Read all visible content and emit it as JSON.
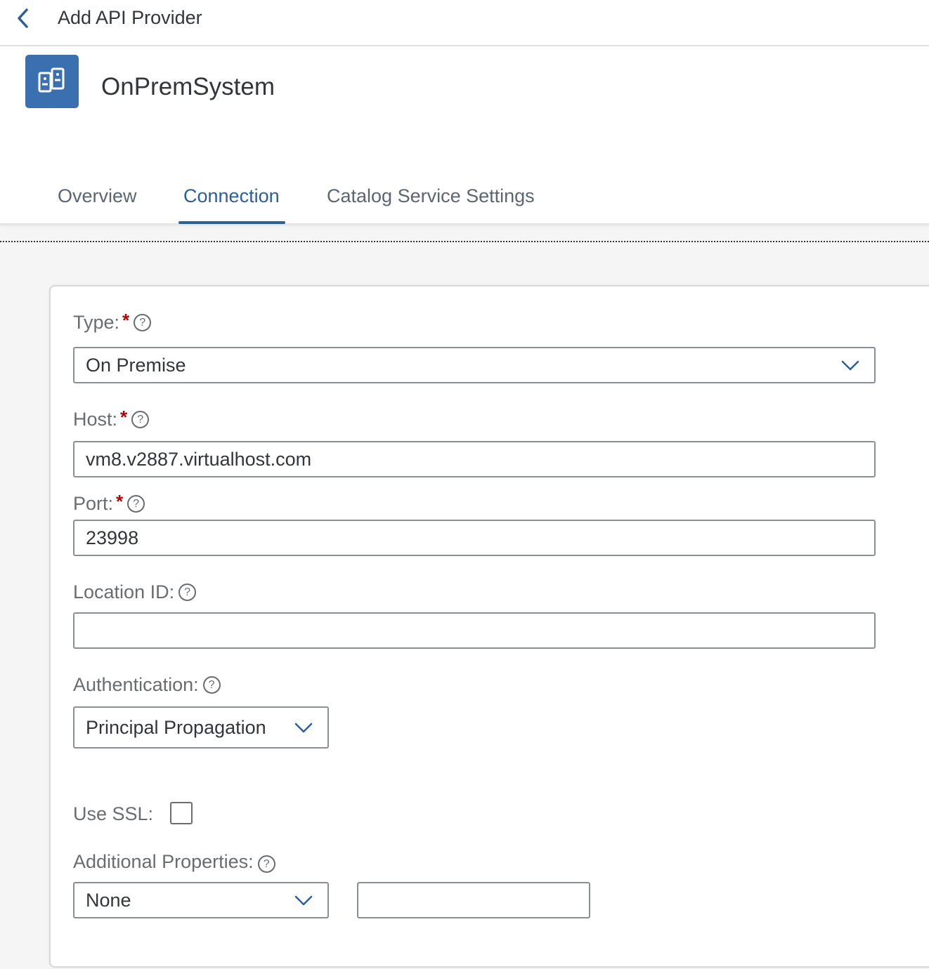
{
  "topbar": {
    "title": "Add API Provider"
  },
  "header": {
    "title": "OnPremSystem"
  },
  "tabs": [
    {
      "label": "Overview"
    },
    {
      "label": "Connection"
    },
    {
      "label": "Catalog Service Settings"
    }
  ],
  "form": {
    "type": {
      "label": "Type:",
      "value": "On Premise"
    },
    "host": {
      "label": "Host:",
      "value": "vm8.v2887.virtualhost.com"
    },
    "port": {
      "label": "Port:",
      "value": "23998"
    },
    "location": {
      "label": "Location ID:",
      "value": ""
    },
    "authentication": {
      "label": "Authentication:",
      "value": "Principal Propagation"
    },
    "ssl": {
      "label": "Use SSL:",
      "checked": false
    },
    "additional": {
      "label": "Additional Properties:",
      "select_value": "None",
      "text_value": ""
    },
    "required_marker": "*",
    "help_glyph": "?"
  },
  "colors": {
    "accent": "#2a5f9e",
    "icon_bg": "#3a6fb0",
    "required": "#bb0000"
  },
  "icons": {
    "back": "chevron-left-icon",
    "object": "phone-device-icon",
    "dropdown": "chevron-down-icon"
  }
}
